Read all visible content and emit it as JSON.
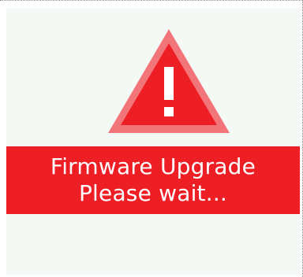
{
  "colors": {
    "background": "#ffffff",
    "panel": "#f4f9f6",
    "accent_red": "#ee1e25",
    "warning_outer": "#f27679",
    "banner_text": "#ffffff",
    "frame": "#8a8a8a"
  },
  "warning": {
    "icon": "warning-triangle-icon",
    "glyph": "!"
  },
  "message": {
    "line1": "Firmware Upgrade",
    "line2": "Please wait..."
  }
}
